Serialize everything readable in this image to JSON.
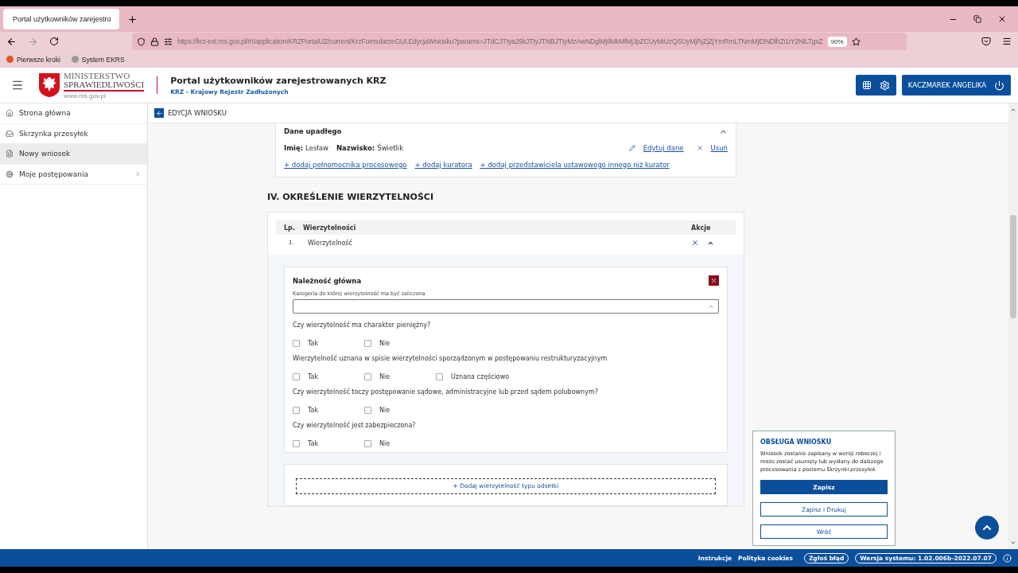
{
  "browser": {
    "tab_title": "Portal użytkowników zarejestro",
    "url": "https://krz-ext.ms.gov.pl/#!/application/KRZPortalUZ/current/KrzFormularzeGUI.EdycjaWniosku?params=JTdCJTIya29kJTIyJTNBJTIyMzAwNDglMjIlMkMlMjJpZCUyMiUzQSUyMjRjZjZjYmRmLTNmMjEtNDlhZi1iY2NlLTgxZ",
    "zoom": "90%",
    "bookmarks": [
      "Pierwsze kroki",
      "System EKRS"
    ]
  },
  "header": {
    "logo_line1": "MINISTERSTWO",
    "logo_line2": "SPRAWIEDLIWOŚCI",
    "logo_url": "www.ms.gov.pl",
    "title": "Portal użytkowników zarejestrowanych KRZ",
    "subtitle": "KRZ - Krajowy Rejestr Zadłużonych",
    "user_name": "KACZMAREK ANGELIKA"
  },
  "sidebar": {
    "items": [
      {
        "label": "Strona główna",
        "kind": "home",
        "selected": false,
        "expandable": false
      },
      {
        "label": "Skrzynka przesyłek",
        "kind": "inbox",
        "selected": false,
        "expandable": false
      },
      {
        "label": "Nowy wniosek",
        "kind": "document",
        "selected": true,
        "expandable": false
      },
      {
        "label": "Moje postępowania",
        "kind": "gear",
        "selected": false,
        "expandable": true
      }
    ]
  },
  "page_bar": {
    "title": "EDYCJA WNIOSKU"
  },
  "debtor_card": {
    "title": "Dane upadłego",
    "expanded": true,
    "fields": [
      {
        "label": "Imię:",
        "value": "Lesław"
      },
      {
        "label": "Nazwisko:",
        "value": "Świetlik"
      }
    ],
    "edit_link": "Edytuj dane",
    "remove_link": "Usuń",
    "add_links": [
      "+ dodaj pełnomocnika procesowego",
      "+ dodaj kuratora",
      "+ dodaj przedstawiciela ustawowego innego niż kurator"
    ]
  },
  "section_title": "IV. OKREŚLENIE WIERZYTELNOŚCI",
  "claims_table": {
    "columns": [
      "Lp.",
      "Wierzytelności",
      "Akcje"
    ],
    "rows": [
      {
        "number": "1.",
        "name": "Wierzytelność",
        "expanded": true
      }
    ]
  },
  "claim_form": {
    "title": "Należność główna",
    "category_label": "Kategoria do której wierzytelność ma być zaliczona",
    "category_open": true,
    "questions": [
      {
        "text": "Czy wierzytelność ma charakter pieniężny?",
        "options": [
          {
            "label": "Tak",
            "checked": false
          },
          {
            "label": "Nie",
            "checked": false
          }
        ]
      },
      {
        "text": "Wierzytelność uznana w spisie wierzytelności sporządzonym w postępowaniu restrukturyzacyjnym",
        "options": [
          {
            "label": "Tak",
            "checked": false
          },
          {
            "label": "Nie",
            "checked": false
          },
          {
            "label": "Uznana częściowo",
            "checked": false
          }
        ]
      },
      {
        "text": "Czy wierzytelność toczy postępowanie sądowe, administracyjne lub przed sądem polubownym?",
        "options": [
          {
            "label": "Tak",
            "checked": false
          },
          {
            "label": "Nie",
            "checked": false
          }
        ]
      },
      {
        "text": "Czy wierzytelność jest zabezpieczona?",
        "options": [
          {
            "label": "Tak",
            "checked": false
          },
          {
            "label": "Nie",
            "checked": false
          }
        ]
      }
    ],
    "add_button": "+ Dodaj wierzytelność typu odsetki"
  },
  "side_panel": {
    "title": "OBSŁUGA WNIOSKU",
    "text": "Wniosek zostanie zapisany w wersji roboczej i może zostać usunięty lub wysłany do dalszego procesowania z poziomu *Skrzynki przesyłek*.",
    "buttons": [
      {
        "label": "Zapisz",
        "kind": "primary"
      },
      {
        "label": "Zapisz i Drukuj",
        "kind": "secondary"
      },
      {
        "label": "Wróć",
        "kind": "secondary"
      }
    ]
  },
  "footer": {
    "links": [
      "Instrukcje",
      "Polityka cookies"
    ],
    "badges": [
      "Zgłoś błąd",
      "Wersja systemu: 1.02.006b-2022.07.07"
    ]
  }
}
